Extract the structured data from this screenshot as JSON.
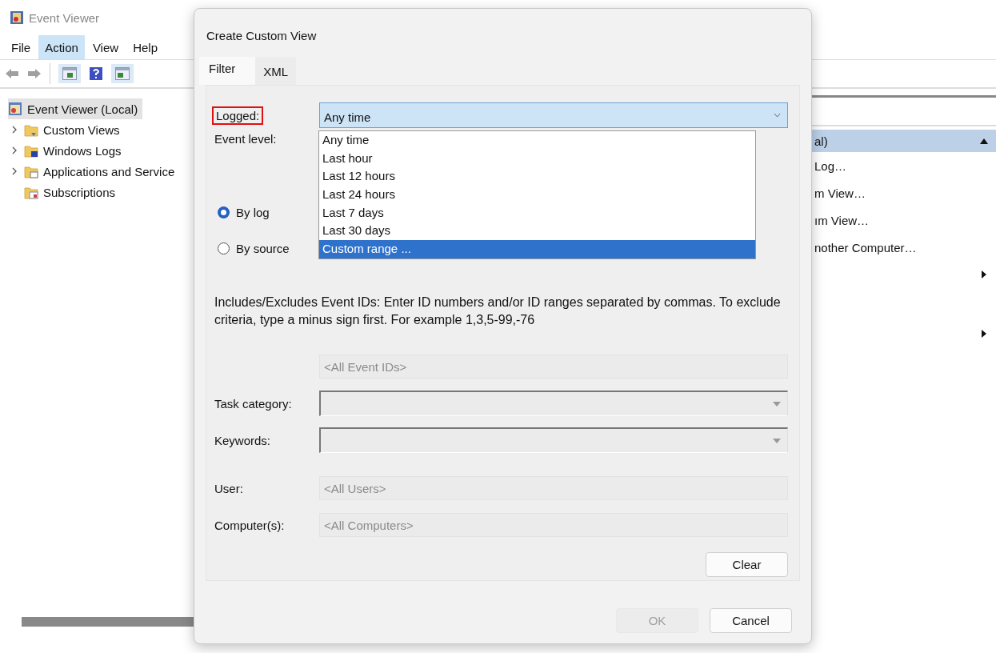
{
  "app": {
    "title": "Event Viewer",
    "menu": [
      {
        "label": "File",
        "selected": false
      },
      {
        "label": "Action",
        "selected": true
      },
      {
        "label": "View",
        "selected": false
      },
      {
        "label": "Help",
        "selected": false
      }
    ],
    "tree": {
      "label": "Event Viewer (Local)",
      "selected": true,
      "children": [
        {
          "label": "Custom Views",
          "kind": "folder",
          "expandable": true
        },
        {
          "label": "Windows Logs",
          "kind": "logs",
          "expandable": true
        },
        {
          "label": "Applications and Service",
          "kind": "apps",
          "expandable": true
        },
        {
          "label": "Subscriptions",
          "kind": "subs",
          "expandable": false
        }
      ]
    },
    "actions": {
      "header": "al)",
      "items": [
        {
          "kind": "action",
          "label": "Log…"
        },
        {
          "kind": "action",
          "label": "m View…"
        },
        {
          "kind": "action",
          "label": "ım View…"
        },
        {
          "kind": "action",
          "label": "nother Computer…"
        },
        {
          "kind": "submenu"
        },
        {
          "kind": "submenu"
        }
      ]
    }
  },
  "dialog": {
    "title": "Create Custom View",
    "tabs": [
      {
        "label": "Filter",
        "selected": true
      },
      {
        "label": "XML",
        "selected": false
      }
    ],
    "logged": {
      "label": "Logged:",
      "highlighted": true,
      "value": "Any time",
      "options": [
        {
          "label": "Any time",
          "highlighted": false
        },
        {
          "label": "Last hour",
          "highlighted": false
        },
        {
          "label": "Last 12 hours",
          "highlighted": false
        },
        {
          "label": "Last 24 hours",
          "highlighted": false
        },
        {
          "label": "Last 7 days",
          "highlighted": false
        },
        {
          "label": "Last 30 days",
          "highlighted": false
        },
        {
          "label": "Custom range ...",
          "highlighted": true
        }
      ]
    },
    "event_level": {
      "label": "Event level:"
    },
    "radios": [
      {
        "label": "By log",
        "selected": true
      },
      {
        "label": "By source",
        "selected": false
      }
    ],
    "description": "Includes/Excludes Event IDs: Enter ID numbers and/or ID ranges separated by commas. To exclude criteria, type a minus sign first. For example 1,3,5-99,-76",
    "event_ids": {
      "placeholder": "<All Event IDs>"
    },
    "task_category": {
      "label": "Task category:"
    },
    "keywords": {
      "label": "Keywords:"
    },
    "user": {
      "label": "User:",
      "placeholder": "<All Users>"
    },
    "computers": {
      "label": "Computer(s):",
      "placeholder": "<All Computers>"
    },
    "clear_button": {
      "label": "Clear"
    },
    "ok_button": {
      "label": "OK",
      "disabled": true
    },
    "cancel_button": {
      "label": "Cancel",
      "disabled": false
    }
  }
}
